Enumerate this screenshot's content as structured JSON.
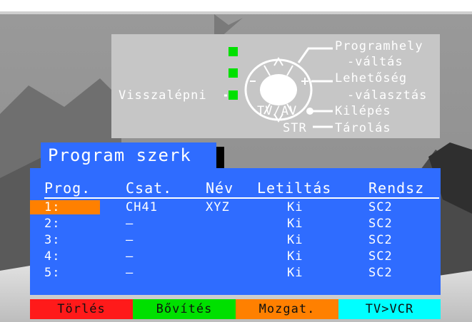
{
  "help": {
    "back_label": "Visszalépni",
    "program_change": [
      "Programhely",
      "-váltás"
    ],
    "option_select": [
      "Lehetőség",
      "-választás"
    ],
    "tvav_label": "TV/AV",
    "exit_label": "Kilépés",
    "str_label": "STR",
    "store_label": "Tárolás",
    "remote_icon": "remote-dpad-icon"
  },
  "title": "Program szerk",
  "table": {
    "headers": [
      "Prog.",
      "Csat.",
      "Név",
      "Letiltás",
      "Rendsz"
    ],
    "selected_row": 1,
    "rows": [
      {
        "prog": "1:",
        "csat": "CH41",
        "nev": "XYZ",
        "letiltas": "Ki",
        "rendsz": "SC2"
      },
      {
        "prog": "2:",
        "csat": "–",
        "nev": "",
        "letiltas": "Ki",
        "rendsz": "SC2"
      },
      {
        "prog": "3:",
        "csat": "–",
        "nev": "",
        "letiltas": "Ki",
        "rendsz": "SC2"
      },
      {
        "prog": "4:",
        "csat": "–",
        "nev": "",
        "letiltas": "Ki",
        "rendsz": "SC2"
      },
      {
        "prog": "5:",
        "csat": "–",
        "nev": "",
        "letiltas": "Ki",
        "rendsz": "SC2"
      }
    ]
  },
  "keys": [
    {
      "label": "Törlés",
      "color": "#ff1a1a"
    },
    {
      "label": "Bővítés",
      "color": "#00e000"
    },
    {
      "label": "Mozgat.",
      "color": "#ff8000"
    },
    {
      "label": "TV>VCR",
      "color": "#00ffff"
    }
  ],
  "colors": {
    "panel_blue": "#2f6cff",
    "help_gray": "#c6c6c6",
    "selection": "#ff8000",
    "green_button": "#00e000"
  }
}
